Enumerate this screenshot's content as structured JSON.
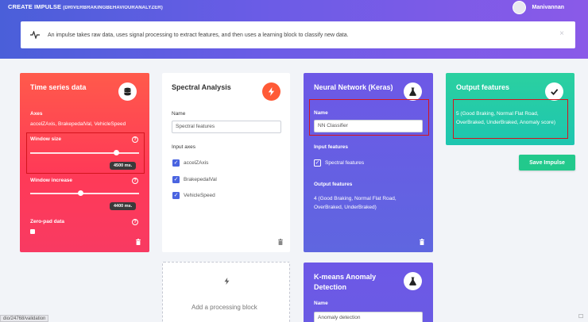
{
  "header": {
    "title": "CREATE IMPULSE",
    "project": "(DRIVERBRAKINGBEHAVIOURANALYZER)",
    "user_name": "Manivannan"
  },
  "info": {
    "text": "An impulse takes raw data, uses signal processing to extract features, and then uses a learning block to classify new data."
  },
  "time_series": {
    "title": "Time series data",
    "axes_label": "Axes",
    "axes_value": "accelZAxis, BrakepedalVal, VehicleSpeed",
    "window_size_label": "Window size",
    "window_size_value": "4500 ms.",
    "window_size_fraction": 0.79,
    "window_increase_label": "Window increase",
    "window_increase_value": "4400 ms.",
    "window_increase_fraction": 0.46,
    "zero_pad_label": "Zero-pad data",
    "help": "?",
    "icon": "database-icon",
    "color": "#ff3e55"
  },
  "spectral": {
    "title": "Spectral Analysis",
    "name_label": "Name",
    "name_value": "Spectral features",
    "input_axes_label": "Input axes",
    "axes": [
      "accelZAxis",
      "BrakepedalVal",
      "VehicleSpeed"
    ],
    "check": "✓",
    "icon": "lightning-icon",
    "icon_color": "#ff5a36"
  },
  "add_block": {
    "label": "Add a processing block",
    "icon": "lightning-icon"
  },
  "neural_network": {
    "title": "Neural Network (Keras)",
    "name_label": "Name",
    "name_value": "NN Classifier",
    "input_features_label": "Input features",
    "input_feature": "Spectral features",
    "check": "✓",
    "output_features_label": "Output features",
    "output_features_value": "4 (Good Braking, Normal Flat Road, OverBraked, UnderBraked)",
    "icon": "flask-icon"
  },
  "kmeans": {
    "title": "K-means Anomaly Detection",
    "name_label": "Name",
    "name_value": "Anomaly detection",
    "icon": "flask-icon"
  },
  "output_features": {
    "title": "Output features",
    "value": "5 (Good Braking, Normal Flat Road, OverBraked, UnderBraked, Anomaly score)",
    "icon": "check-icon"
  },
  "save_button": "Save Impulse",
  "status_url": "dio/24768/validation"
}
